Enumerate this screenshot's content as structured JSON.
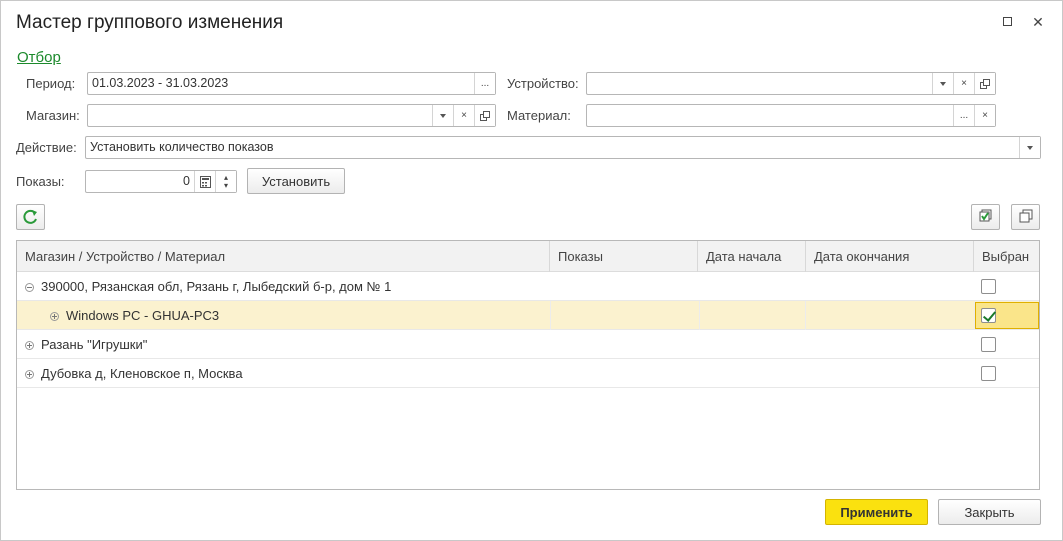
{
  "window": {
    "title": "Мастер группового изменения"
  },
  "filter": {
    "link": "Отбор",
    "period_label": "Период:",
    "period_value": "01.03.2023 - 31.03.2023",
    "device_label": "Устройство:",
    "device_value": "",
    "shop_label": "Магазин:",
    "shop_value": "",
    "material_label": "Материал:",
    "material_value": ""
  },
  "action": {
    "label": "Действие:",
    "value": "Установить количество показов"
  },
  "shows": {
    "label": "Показы:",
    "value": "0",
    "set_button": "Установить"
  },
  "toolbar": {
    "ellipsis": "...",
    "clear": "×"
  },
  "table": {
    "columns": [
      "Магазин / Устройство / Материал",
      "Показы",
      "Дата начала",
      "Дата окончания",
      "Выбран"
    ],
    "rows": [
      {
        "name": "390000, Рязанская обл, Рязань г, Лыбедский б-р, дом № 1",
        "shows": "",
        "start": "",
        "end": "",
        "checked": false,
        "expanded": true
      },
      {
        "name": "Windows PC - GHUA-PC3",
        "shows": "",
        "start": "",
        "end": "",
        "checked": true,
        "expanded": false
      },
      {
        "name": "Разань \"Игрушки\"",
        "shows": "",
        "start": "",
        "end": "",
        "checked": false,
        "expanded": false
      },
      {
        "name": "Дубовка д, Кленовское п, Москва",
        "shows": "",
        "start": "",
        "end": "",
        "checked": false,
        "expanded": false
      }
    ]
  },
  "footer": {
    "apply": "Применить",
    "close": "Закрыть"
  },
  "colors": {
    "accent_button": "#fae10f",
    "link": "#1c8a2c",
    "selected_row": "#fbf2cf",
    "check": "#1a7a2a"
  }
}
